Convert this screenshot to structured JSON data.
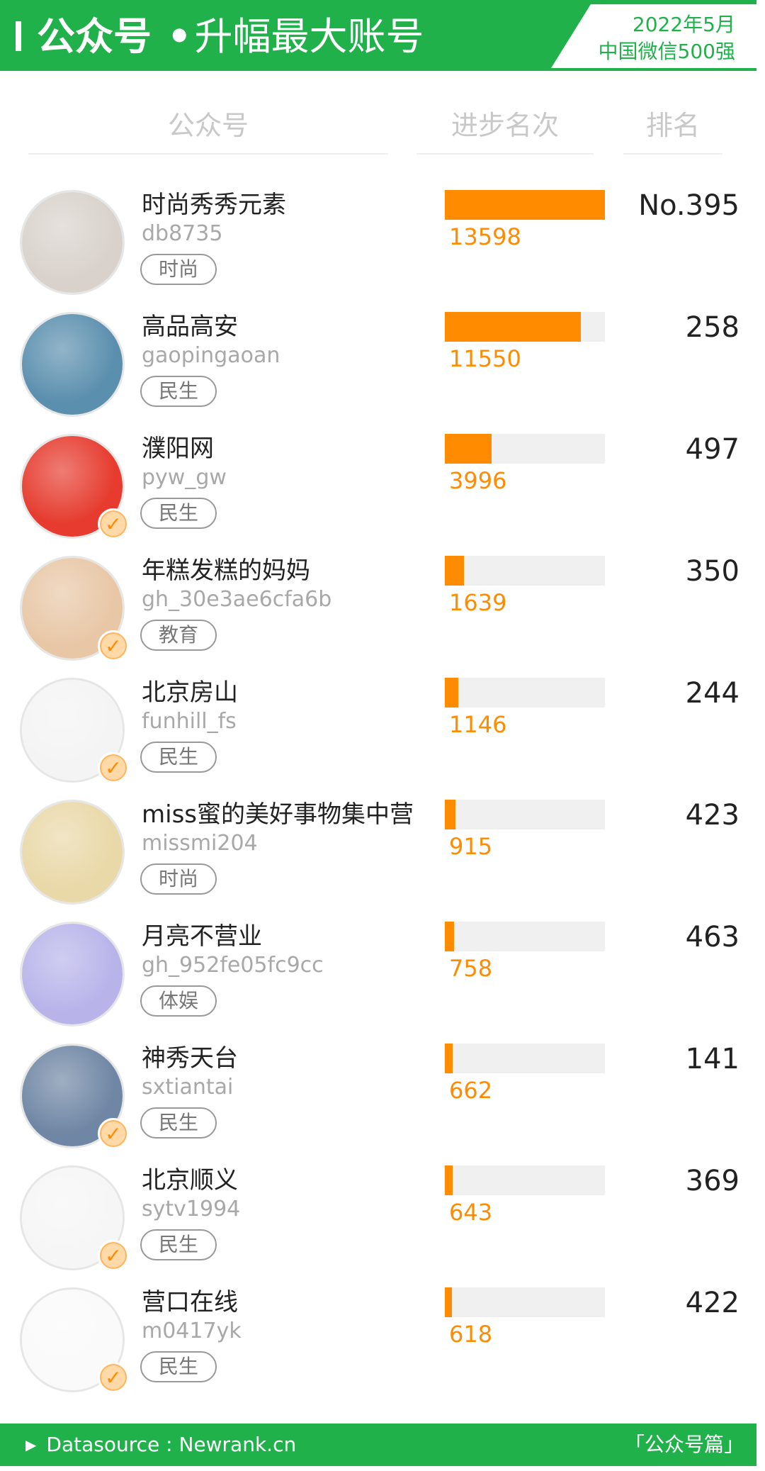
{
  "header": {
    "title_bold": "公众号",
    "title_dot": "•",
    "title_rest": "升幅最大账号",
    "badge_line1": "2022年5月",
    "badge_line2": "中国微信500强"
  },
  "columns": {
    "account": "公众号",
    "progress": "进步名次",
    "rank": "排名"
  },
  "colors": {
    "brand_green": "#21b14b",
    "bar_orange": "#ff8c00",
    "bar_track": "#f0f0f0"
  },
  "bar_max": 13598,
  "rows": [
    {
      "name": "时尚秀秀元素",
      "account": "db8735",
      "tag": "时尚",
      "progress": 13598,
      "progress_label": "13598",
      "rank": "No.395",
      "verified": false,
      "avatar": "portrait-photo",
      "avatar_color": "#d9d2cc"
    },
    {
      "name": "高品高安",
      "account": "gaopingaoan",
      "tag": "民生",
      "progress": 11550,
      "progress_label": "11550",
      "rank": "258",
      "verified": false,
      "avatar": "landscape-photo",
      "avatar_color": "#5b8fae"
    },
    {
      "name": "濮阳网",
      "account": "pyw_gw",
      "tag": "民生",
      "progress": 3996,
      "progress_label": "3996",
      "rank": "497",
      "verified": true,
      "avatar": "濮阳网-logo",
      "avatar_color": "#e63b2e"
    },
    {
      "name": "年糕发糕的妈妈",
      "account": "gh_30e3ae6cfa6b",
      "tag": "教育",
      "progress": 1639,
      "progress_label": "1639",
      "rank": "350",
      "verified": true,
      "avatar": "family-photo",
      "avatar_color": "#e8c7a6"
    },
    {
      "name": "北京房山",
      "account": "funhill_fs",
      "tag": "民生",
      "progress": 1146,
      "progress_label": "1146",
      "rank": "244",
      "verified": true,
      "avatar": "funhill-logo",
      "avatar_color": "#f4f4f4"
    },
    {
      "name": "miss蜜的美好事物集中营",
      "account": "missmi204",
      "tag": "时尚",
      "progress": 915,
      "progress_label": "915",
      "rank": "423",
      "verified": false,
      "avatar": "portrait-photo",
      "avatar_color": "#e9d8a8"
    },
    {
      "name": "月亮不营业",
      "account": "gh_952fe05fc9cc",
      "tag": "体娱",
      "progress": 758,
      "progress_label": "758",
      "rank": "463",
      "verified": false,
      "avatar": "moon-illustration",
      "avatar_color": "#b8b4ea"
    },
    {
      "name": "神秀天台",
      "account": "sxtiantai",
      "tag": "民生",
      "progress": 662,
      "progress_label": "662",
      "rank": "141",
      "verified": true,
      "avatar": "pavilion-photo",
      "avatar_color": "#6f86a4"
    },
    {
      "name": "北京顺义",
      "account": "sytv1994",
      "tag": "民生",
      "progress": 643,
      "progress_label": "643",
      "rank": "369",
      "verified": true,
      "avatar": "shunyi-logo",
      "avatar_color": "#f6f6f6"
    },
    {
      "name": "营口在线",
      "account": "m0417yk",
      "tag": "民生",
      "progress": 618,
      "progress_label": "618",
      "rank": "422",
      "verified": true,
      "avatar": "城市-seal-logo",
      "avatar_color": "#fafafa"
    }
  ],
  "footer": {
    "source": "Datasource : Newrank.cn",
    "section": "「公众号篇」"
  }
}
